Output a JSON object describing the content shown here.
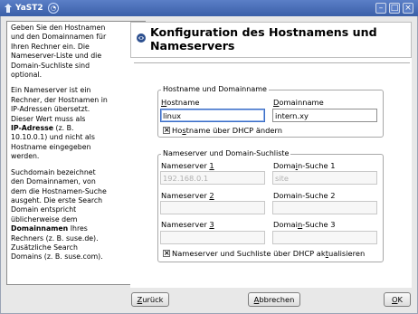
{
  "window": {
    "title": "YaST2"
  },
  "help": {
    "paragraphs": [
      [
        "Geben Sie den Hostnamen",
        "und den Domainnamen für",
        "Ihren Rechner ein. Die",
        "Nameserver-Liste und die",
        "Domain-Suchliste sind",
        "optional."
      ],
      [
        "Ein Nameserver ist ein",
        "Rechner, der Hostnamen in",
        "IP-Adressen übersetzt.",
        "Dieser Wert muss als"
      ],
      [
        "Suchdomain bezeichnet",
        "den Domainnamen, von",
        "dem die Hostnamen-Suche",
        "ausgeht. Die erste Search",
        "Domain entspricht",
        "üblicherweise dem"
      ]
    ],
    "p2_bold": "IP-Adresse",
    "p2_tail_1": " (z. B.",
    "p2_tail_2": "10.10.0.1) und nicht als",
    "p2_tail_3": "Hostname eingegeben",
    "p2_tail_4": "werden.",
    "p3_bold": "Domainnamen",
    "p3_tail_1": " Ihres",
    "p3_tail_2": "Rechners (z. B. suse.de).",
    "p3_tail_3": "Zusätzliche Search",
    "p3_tail_4": "Domains (z. B. suse.com)."
  },
  "page": {
    "title": "Konfiguration des Hostnamens und Nameservers"
  },
  "hostname_group": {
    "legend": "Hostname und Domainname",
    "hostname_label_pre": "",
    "hostname_label_u": "H",
    "hostname_label_post": "ostname",
    "hostname_value": "linux",
    "domain_label_pre": "",
    "domain_label_u": "D",
    "domain_label_post": "omainname",
    "domain_value": "intern.xy",
    "dhcp_check_pre": "Ho",
    "dhcp_check_u": "s",
    "dhcp_check_post": "tname über DHCP ändern",
    "dhcp_checked": true
  },
  "nameserver_group": {
    "legend": "Nameserver und Domain-Suchliste",
    "ns1_label_pre": "Nameserver ",
    "ns1_label_u": "1",
    "ns1_label_post": "",
    "ns1_value": "192.168.0.1",
    "ds1_label_pre": "Doma",
    "ds1_label_u": "i",
    "ds1_label_post": "n-Suche 1",
    "ds1_value": "site",
    "ns2_label_pre": "Nameserver ",
    "ns2_label_u": "2",
    "ns2_label_post": "",
    "ds2_label": "Domain-Suche 2",
    "ns3_label_pre": "Nameserver ",
    "ns3_label_u": "3",
    "ns3_label_post": "",
    "ds3_label_pre": "Domai",
    "ds3_label_u": "n",
    "ds3_label_post": "-Suche 3",
    "dhcp_check_pre": "Nameserver und Suchliste über DHCP ak",
    "dhcp_check_u": "t",
    "dhcp_check_post": "ualisieren",
    "dhcp_checked": true
  },
  "footer": {
    "back_pre": "",
    "back_u": "Z",
    "back_post": "urück",
    "abort_pre": "",
    "abort_u": "A",
    "abort_post": "bbrechen",
    "ok_pre": "",
    "ok_u": "O",
    "ok_post": "K"
  },
  "colors": {
    "titlebar": "#3a5fa8",
    "focus": "#3b6cc4"
  }
}
